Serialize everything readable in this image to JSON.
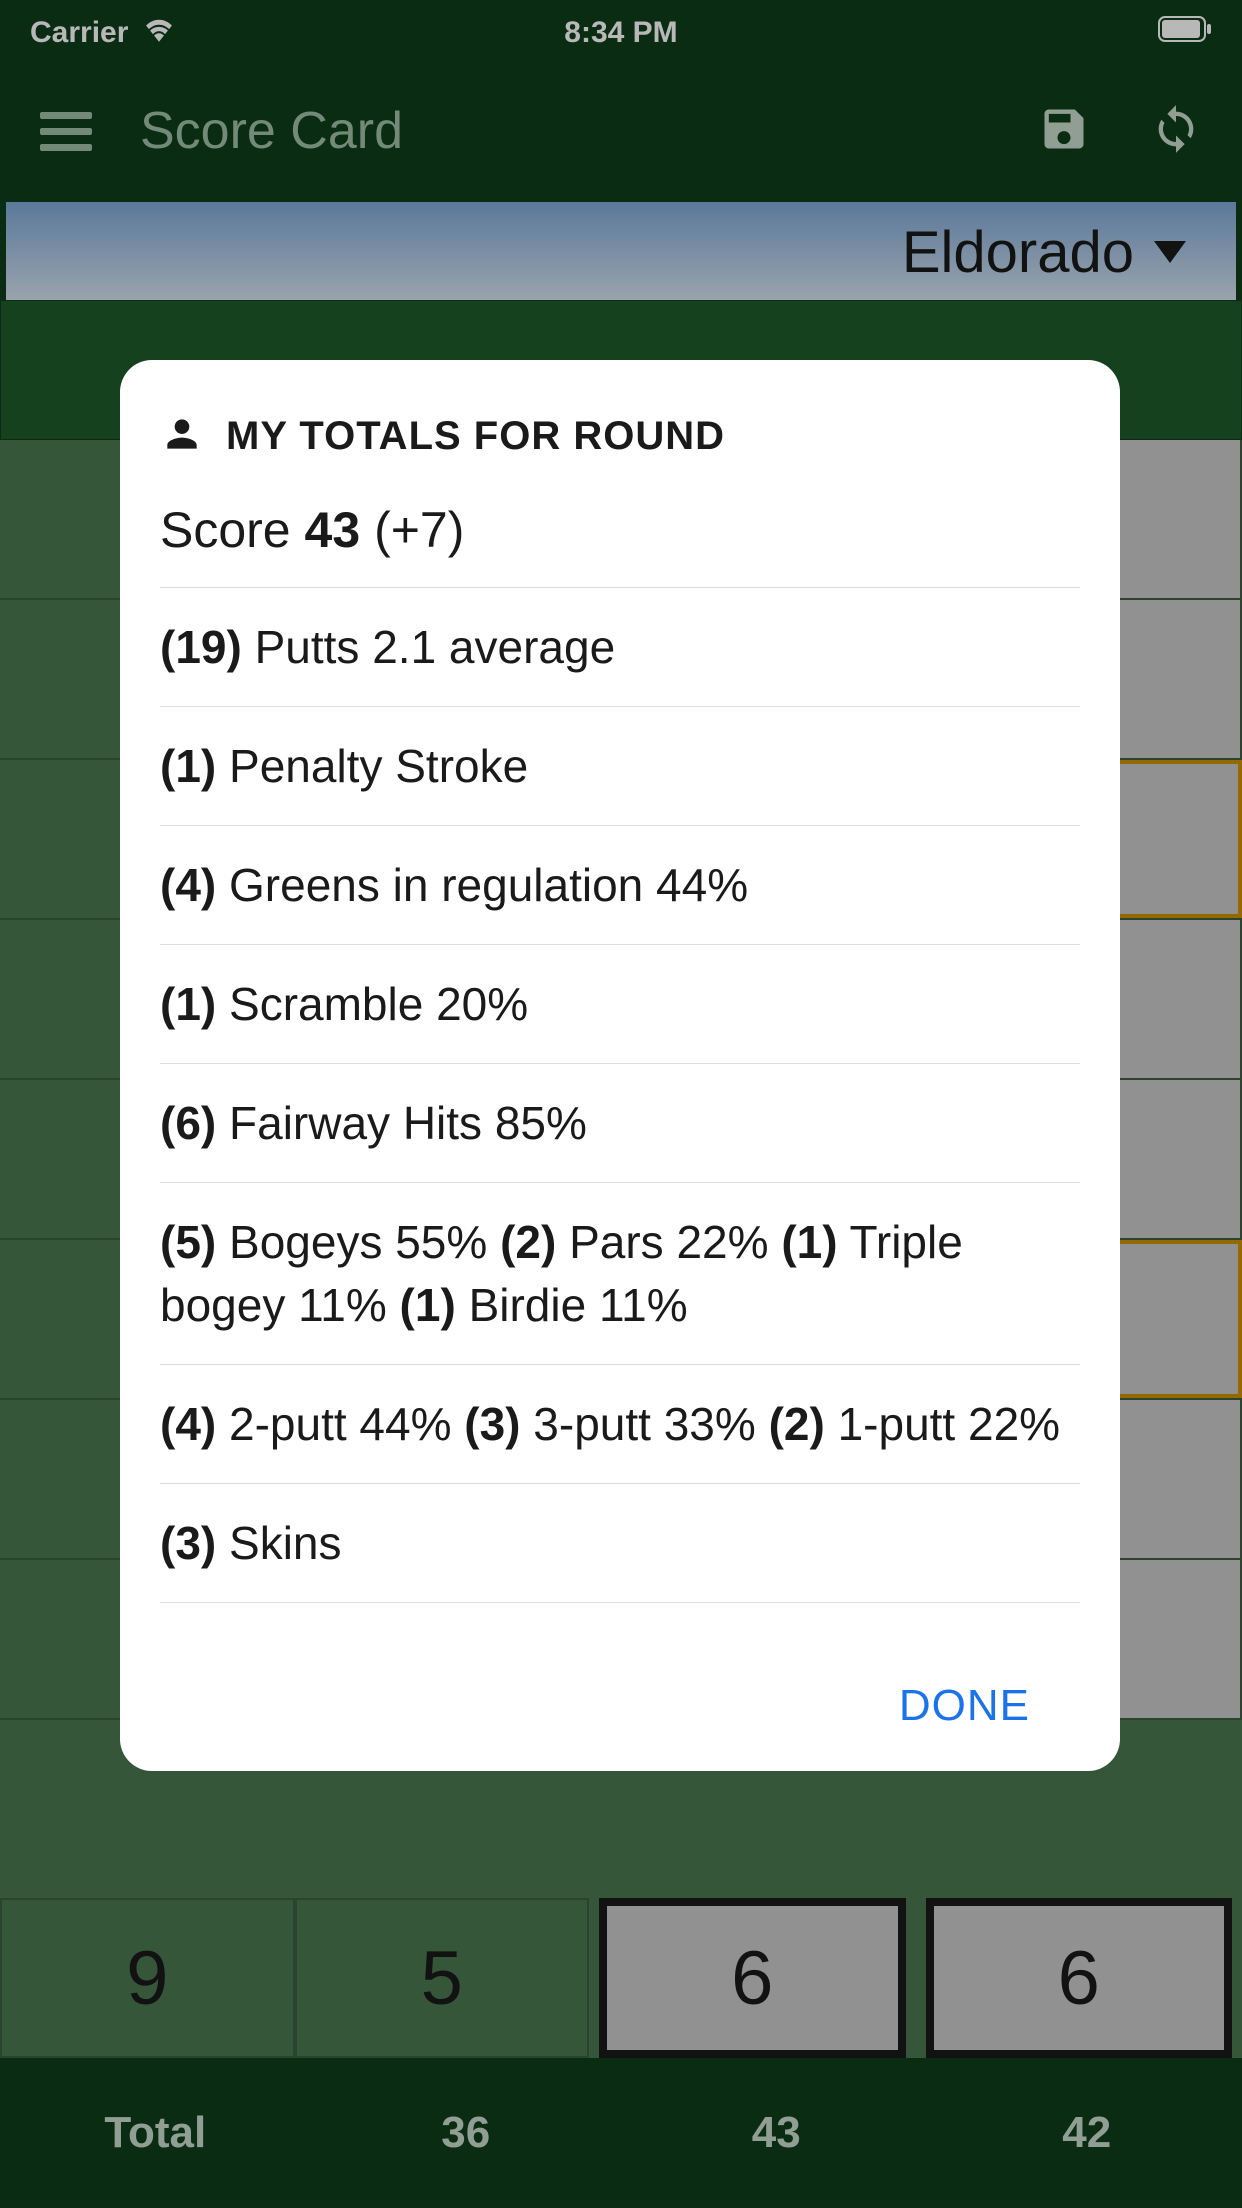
{
  "status": {
    "carrier": "Carrier",
    "time": "8:34 PM"
  },
  "header": {
    "title": "Score Card"
  },
  "course": {
    "name": "Eldorado"
  },
  "modal": {
    "title": "MY TOTALS FOR ROUND",
    "score_label": "Score",
    "score_value": "43",
    "score_diff": "(+7)",
    "putts_count": "(19)",
    "putts_text": "Putts 2.1 average",
    "penalty_count": "(1)",
    "penalty_text": "Penalty Stroke",
    "gir_count": "(4)",
    "gir_text": "Greens in regulation 44%",
    "scramble_count": "(1)",
    "scramble_text": "Scramble 20%",
    "fairway_count": "(6)",
    "fairway_text": "Fairway Hits 85%",
    "bogeys_c": "(5)",
    "bogeys_t": "Bogeys 55%",
    "pars_c": "(2)",
    "pars_t": "Pars 22%",
    "triple_c": "(1)",
    "triple_t": "Triple bogey 11%",
    "birdie_c": "(1)",
    "birdie_t": "Birdie 11%",
    "putt2_c": "(4)",
    "putt2_t": "2-putt 44%",
    "putt3_c": "(3)",
    "putt3_t": "3-putt 33%",
    "putt1_c": "(2)",
    "putt1_t": "1-putt 22%",
    "skins_c": "(3)",
    "skins_t": "Skins",
    "done": "DONE"
  },
  "bg_row": {
    "hole": "9",
    "par": "5",
    "c1": "6",
    "c2": "6"
  },
  "totals": {
    "label": "Total",
    "v1": "36",
    "v2": "43",
    "v3": "42"
  }
}
